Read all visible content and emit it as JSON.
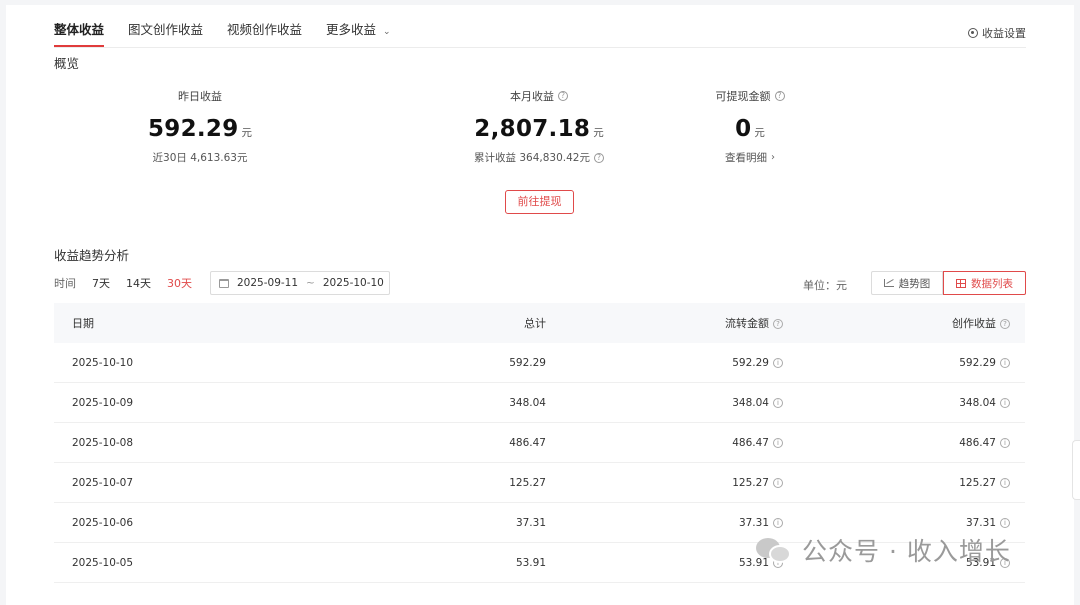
{
  "tabs": [
    {
      "label": "整体收益",
      "active": true
    },
    {
      "label": "图文创作收益",
      "active": false
    },
    {
      "label": "视频创作收益",
      "active": false
    },
    {
      "label": "更多收益",
      "active": false,
      "dropdown": true
    }
  ],
  "settings_label": "收益设置",
  "overview": {
    "title": "概览",
    "yesterday": {
      "label": "昨日收益",
      "value": "592.29",
      "unit": "元",
      "sub": "近30日 4,613.63元"
    },
    "month": {
      "label": "本月收益",
      "value": "2,807.18",
      "unit": "元",
      "sub": "累计收益 364,830.42元"
    },
    "withdrawable": {
      "label": "可提现金额",
      "value": "0",
      "unit": "元",
      "sub": "查看明细"
    },
    "withdraw_button": "前往提现"
  },
  "trend": {
    "title": "收益趋势分析",
    "time_label": "时间",
    "ranges": [
      "7天",
      "14天",
      "30天"
    ],
    "active_range": "30天",
    "date_start": "2025-09-11",
    "date_sep": "~",
    "date_end": "2025-10-10",
    "unit_label": "单位：元",
    "view_chart": "趋势图",
    "view_table": "数据列表"
  },
  "table": {
    "headers": [
      "日期",
      "总计",
      "流转金额",
      "创作收益"
    ],
    "rows": [
      [
        "2025-10-10",
        "592.29",
        "592.29",
        "592.29"
      ],
      [
        "2025-10-09",
        "348.04",
        "348.04",
        "348.04"
      ],
      [
        "2025-10-08",
        "486.47",
        "486.47",
        "486.47"
      ],
      [
        "2025-10-07",
        "125.27",
        "125.27",
        "125.27"
      ],
      [
        "2025-10-06",
        "37.31",
        "37.31",
        "37.31"
      ],
      [
        "2025-10-05",
        "53.91",
        "53.91",
        "53.91"
      ]
    ]
  },
  "watermark": "公众号 · 收入增长",
  "colors": {
    "accent": "#e04a4a",
    "header_bg": "#f7f8fa"
  }
}
